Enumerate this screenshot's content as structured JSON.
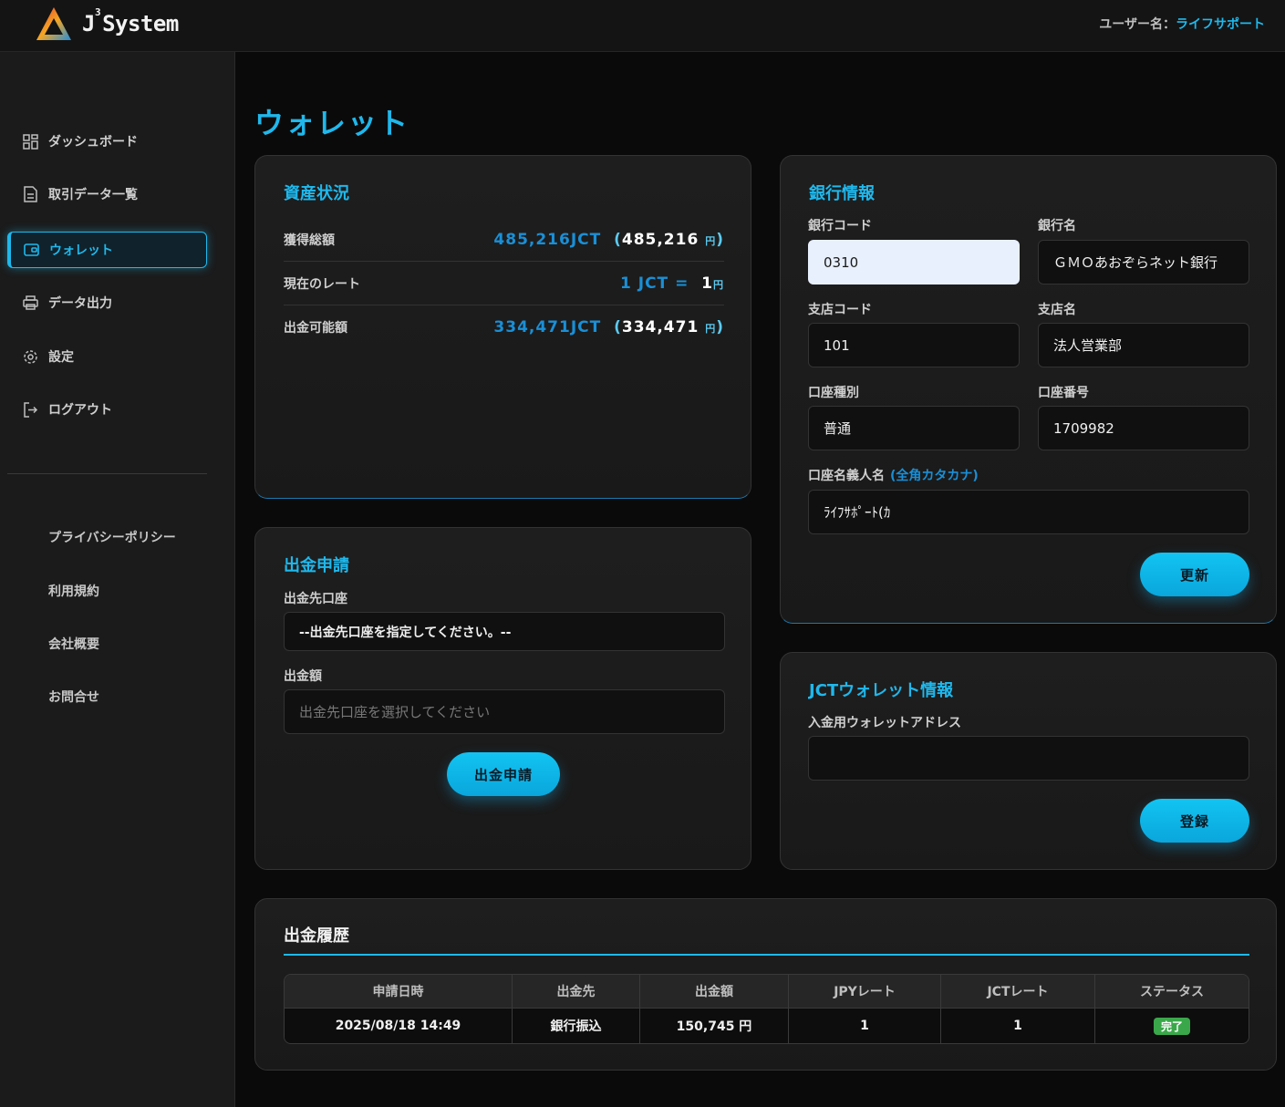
{
  "header": {
    "logo_text": "System",
    "logo_sup": "3",
    "logo_j": "J",
    "user_label": "ユーザー名：",
    "user_name": "ライフサポート"
  },
  "sidebar": {
    "items": [
      {
        "label": "ダッシュボード",
        "icon": "dashboard-icon"
      },
      {
        "label": "取引データ一覧",
        "icon": "document-icon"
      },
      {
        "label": "ウォレット",
        "icon": "wallet-icon"
      },
      {
        "label": "データ出力",
        "icon": "printer-icon"
      },
      {
        "label": "設定",
        "icon": "gear-icon"
      },
      {
        "label": "ログアウト",
        "icon": "logout-icon"
      }
    ],
    "footer_links": [
      "プライバシーポリシー",
      "利用規約",
      "会社概要",
      "お問合せ"
    ]
  },
  "page_title": "ウォレット",
  "assets": {
    "title": "資産状況",
    "rows": [
      {
        "label": "獲得総額",
        "jct": "485,216JCT",
        "yen": "485,216"
      },
      {
        "label": "現在のレート",
        "rate_left": "1 JCT =",
        "rate_right": "1"
      },
      {
        "label": "出金可能額",
        "jct": "334,471JCT",
        "yen": "334,471"
      }
    ],
    "yen_unit": "円"
  },
  "withdraw": {
    "title": "出金申請",
    "account_label": "出金先口座",
    "account_value": "--出金先口座を指定してください。--",
    "amount_label": "出金額",
    "amount_placeholder": "出金先口座を選択してください",
    "submit_label": "出金申請"
  },
  "bank": {
    "title": "銀行情報",
    "bank_code_label": "銀行コード",
    "bank_code": "0310",
    "bank_name_label": "銀行名",
    "bank_name": "ＧＭＯあおぞらネット銀行",
    "branch_code_label": "支店コード",
    "branch_code": "101",
    "branch_name_label": "支店名",
    "branch_name": "法人営業部",
    "account_type_label": "口座種別",
    "account_type": "普通",
    "account_number_label": "口座番号",
    "account_number": "1709982",
    "holder_label": "口座名義人名",
    "holder_hint": "(全角カタカナ)",
    "holder_name": "ﾗｲﾌｻﾎﾟｰﾄ(ｶ",
    "update_label": "更新"
  },
  "jct_wallet": {
    "title": "JCTウォレット情報",
    "address_label": "入金用ウォレットアドレス",
    "address_value": "",
    "register_label": "登録"
  },
  "history": {
    "title": "出金履歴",
    "columns": [
      "申請日時",
      "出金先",
      "出金額",
      "JPYレート",
      "JCTレート",
      "ステータス"
    ],
    "rows": [
      {
        "date": "2025/08/18 14:49",
        "destination": "銀行振込",
        "amount": "150,745 円",
        "jpy_rate": "1",
        "jct_rate": "1",
        "status": "完了"
      }
    ]
  },
  "colors": {
    "accent": "#1fb8ec",
    "background": "#0a0a0a",
    "success": "#3aa84a"
  }
}
